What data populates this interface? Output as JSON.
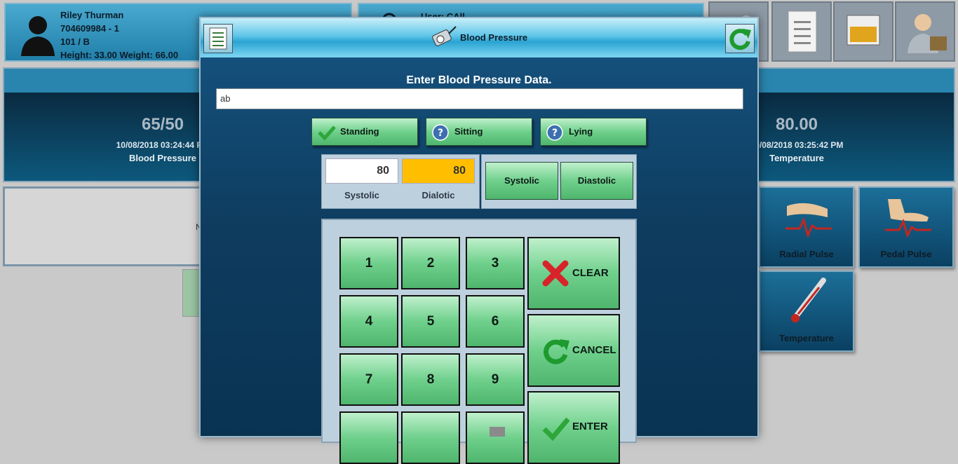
{
  "patient": {
    "name": "Riley Thurman",
    "id": "704609984 - 1",
    "room": "101 / B",
    "height_weight": "Height: 33.00 Weight: 66.00"
  },
  "header2": {
    "text": "User: CAll"
  },
  "vitals": [
    {
      "value": "65/50",
      "date": "10/08/2018 03:24:44 PM",
      "name": "Blood Pressure"
    },
    {
      "value": "80.00",
      "date": "10/08/2018 03:25:42 PM",
      "name": "Temperature"
    }
  ],
  "notes": {
    "text": "N"
  },
  "tiles": [
    {
      "label": "Radial Pulse"
    },
    {
      "label": "Pedal Pulse"
    },
    {
      "label": "Temperature"
    }
  ],
  "modal": {
    "title": "Blood Pressure",
    "prompt": "Enter Blood Pressure Data.",
    "input_value": "ab",
    "positions": [
      "Standing",
      "Sitting",
      "Lying"
    ],
    "readout": {
      "systolic_value": "80",
      "diastolic_value": "80",
      "systolic_label": "Systolic",
      "diastolic_label": "Dialotic"
    },
    "select": {
      "systolic": "Systolic",
      "diastolic": "Diastolic"
    },
    "keys": [
      "1",
      "2",
      "3",
      "4",
      "5",
      "6",
      "7",
      "8",
      "9"
    ],
    "actions": {
      "clear": "CLEAR",
      "cancel": "CANCEL",
      "enter": "ENTER"
    }
  },
  "colors": {
    "accent_green": "#6fd08c",
    "diastolic_highlight": "#ffbf00",
    "header_blue": "#2aa3d2"
  }
}
